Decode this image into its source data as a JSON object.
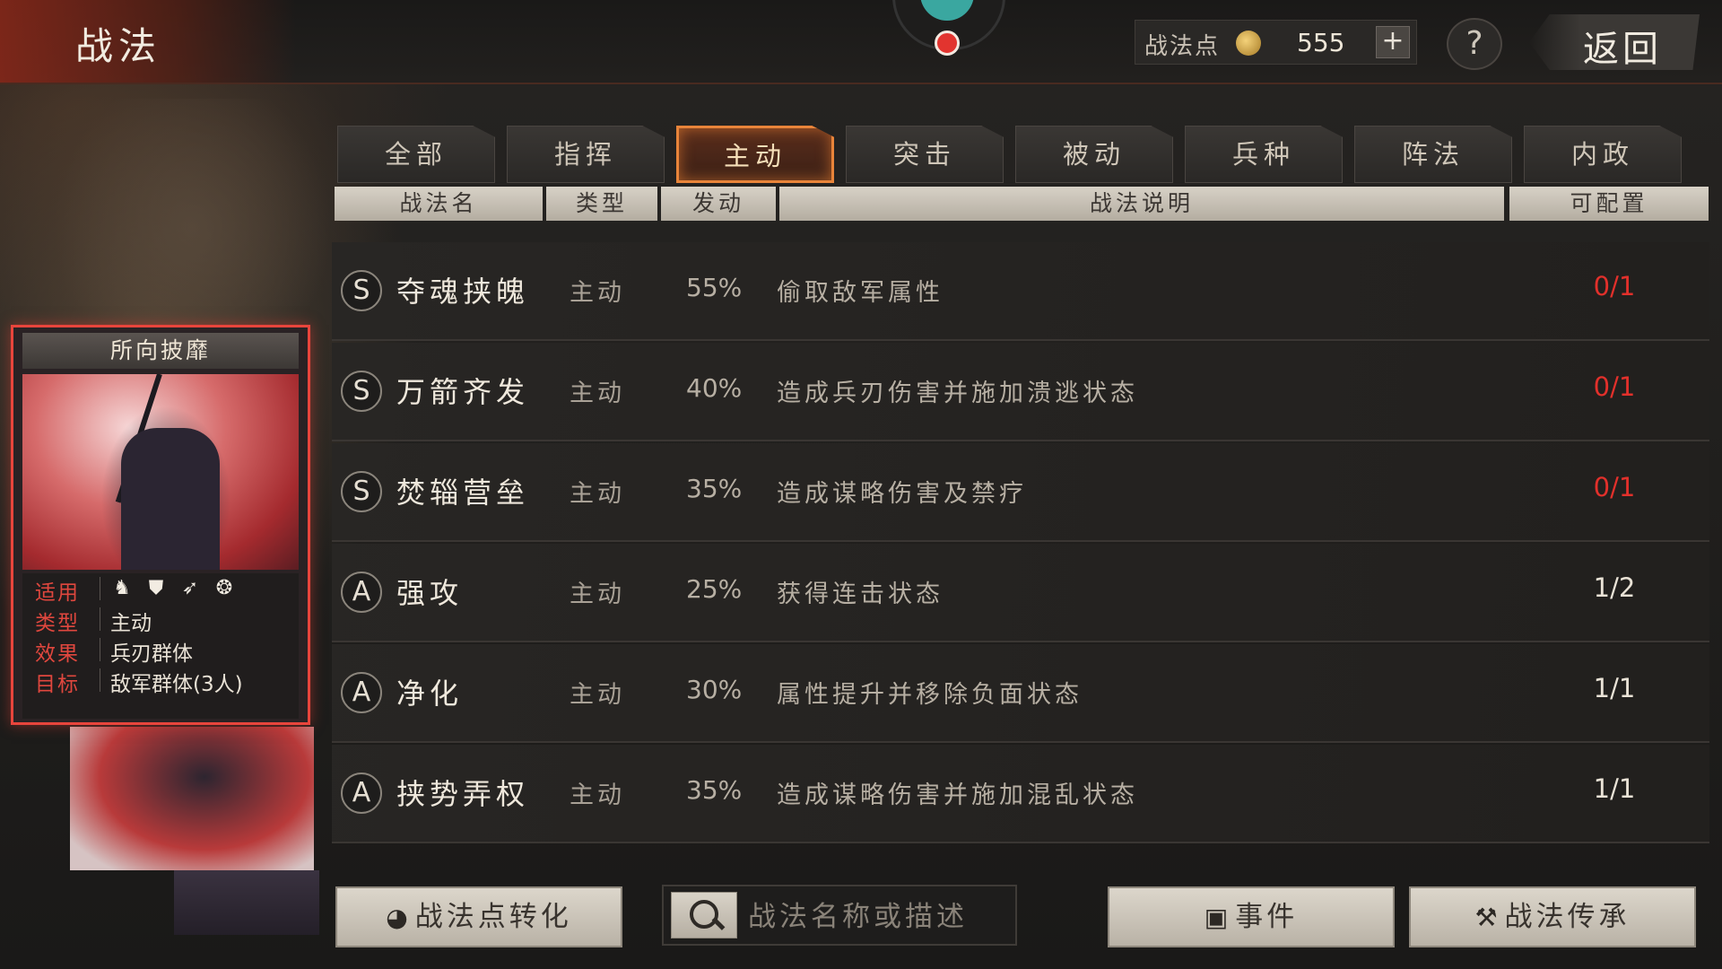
{
  "header": {
    "title": "战法",
    "points_label": "战法点",
    "points_value": "555",
    "plus_label": "+",
    "help_label": "?",
    "back_label": "返回"
  },
  "tabs": [
    {
      "label": "全部"
    },
    {
      "label": "指挥"
    },
    {
      "label": "主动",
      "active": true
    },
    {
      "label": "突击"
    },
    {
      "label": "被动"
    },
    {
      "label": "兵种"
    },
    {
      "label": "阵法"
    },
    {
      "label": "内政"
    }
  ],
  "columns": {
    "name": "战法名",
    "type": "类型",
    "rate": "发动",
    "desc": "战法说明",
    "slots": "可配置"
  },
  "rows": [
    {
      "grade": "S",
      "name": "夺魂挟魄",
      "type": "主动",
      "rate": "55%",
      "desc": "偷取敌军属性",
      "slots": "0/1",
      "full": true
    },
    {
      "grade": "S",
      "name": "万箭齐发",
      "type": "主动",
      "rate": "40%",
      "desc": "造成兵刃伤害并施加溃逃状态",
      "slots": "0/1",
      "full": true
    },
    {
      "grade": "S",
      "name": "焚辎营垒",
      "type": "主动",
      "rate": "35%",
      "desc": "造成谋略伤害及禁疗",
      "slots": "0/1",
      "full": true
    },
    {
      "grade": "A",
      "name": "强攻",
      "type": "主动",
      "rate": "25%",
      "desc": "获得连击状态",
      "slots": "1/2",
      "full": false
    },
    {
      "grade": "A",
      "name": "净化",
      "type": "主动",
      "rate": "30%",
      "desc": "属性提升并移除负面状态",
      "slots": "1/1",
      "full": false
    },
    {
      "grade": "A",
      "name": "挟势弄权",
      "type": "主动",
      "rate": "35%",
      "desc": "造成谋略伤害并施加混乱状态",
      "slots": "1/1",
      "full": false
    }
  ],
  "card": {
    "name": "所向披靡",
    "applicable_label": "适用",
    "troop_icons": [
      "cavalry-icon",
      "shield-icon",
      "bow-icon",
      "chariot-wheel-icon"
    ],
    "type_label": "类型",
    "type_value": "主动",
    "effect_label": "效果",
    "effect_value": "兵刃群体",
    "target_label": "目标",
    "target_value": "敌军群体(3人)"
  },
  "bottom": {
    "convert_label": "战法点转化",
    "search_placeholder": "战法名称或描述",
    "event_label": "事件",
    "inherit_label": "战法传承"
  },
  "colors": {
    "accent_orange": "#e8843a",
    "full_red": "#e2302b",
    "card_border": "#e8453c"
  }
}
